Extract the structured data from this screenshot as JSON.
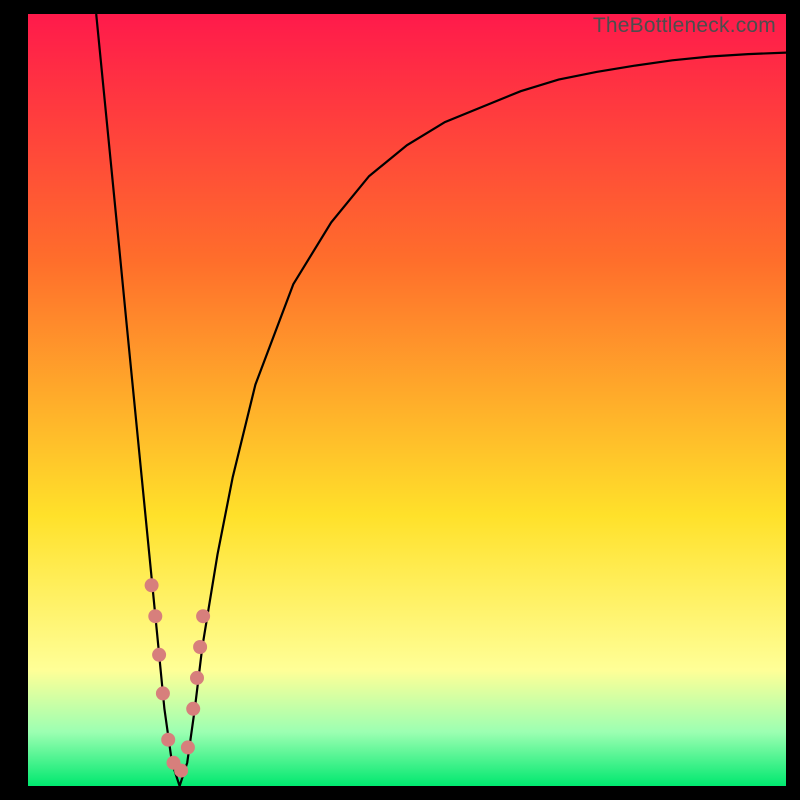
{
  "watermark": "TheBottleneck.com",
  "colors": {
    "top": "#ff1a4b",
    "orange": "#ff6e2b",
    "yellow": "#ffe12a",
    "pale_yellow": "#ffff97",
    "pale_green": "#9cffb2",
    "green": "#00e86f",
    "curve": "#000000",
    "marker": "#d77f7c"
  },
  "chart_data": {
    "type": "line",
    "title": "",
    "xlabel": "",
    "ylabel": "",
    "xlim": [
      0,
      100
    ],
    "ylim": [
      0,
      100
    ],
    "series": [
      {
        "name": "bottleneck-curve",
        "x": [
          9,
          10,
          11,
          12,
          13,
          14,
          15,
          16,
          17,
          18,
          19,
          20,
          21,
          22,
          23,
          25,
          27,
          30,
          35,
          40,
          45,
          50,
          55,
          60,
          65,
          70,
          75,
          80,
          85,
          90,
          95,
          100
        ],
        "y": [
          100,
          90,
          80,
          70,
          60,
          50,
          40,
          30,
          20,
          10,
          3,
          0,
          3,
          10,
          18,
          30,
          40,
          52,
          65,
          73,
          79,
          83,
          86,
          88,
          90,
          91.5,
          92.5,
          93.3,
          94,
          94.5,
          94.8,
          95
        ]
      }
    ],
    "markers": {
      "name": "highlight-points",
      "x": [
        16.3,
        16.8,
        17.3,
        17.8,
        18.5,
        19.2,
        20.2,
        21.1,
        21.8,
        22.3,
        22.7,
        23.1
      ],
      "y": [
        26,
        22,
        17,
        12,
        6,
        3,
        2,
        5,
        10,
        14,
        18,
        22
      ]
    }
  }
}
